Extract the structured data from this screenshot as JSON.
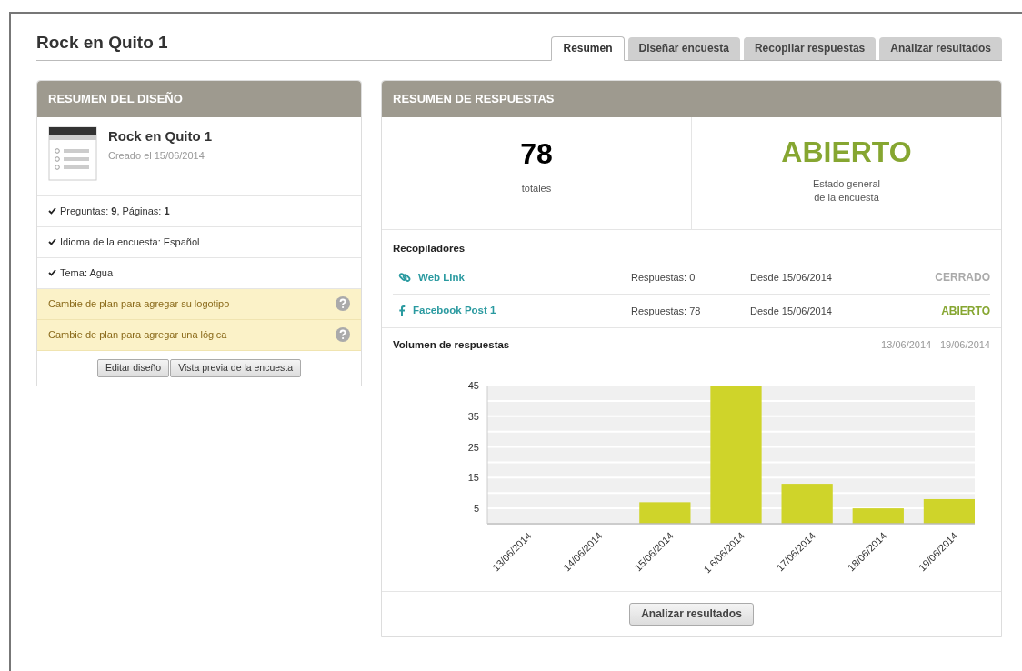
{
  "title": "Rock en Quito 1",
  "tabs": [
    {
      "label": "Resumen",
      "selected": true
    },
    {
      "label": "Diseñar encuesta",
      "selected": false
    },
    {
      "label": "Recopilar respuestas",
      "selected": false
    },
    {
      "label": "Analizar resultados",
      "selected": false
    }
  ],
  "design_summary": {
    "heading": "RESUMEN DEL DISEÑO",
    "survey_name": "Rock en Quito 1",
    "created": "Creado el 15/06/2014",
    "items": [
      {
        "kind": "check",
        "text": "Preguntas: **9**, Páginas: **1**"
      },
      {
        "kind": "check",
        "text": "Idioma de la encuesta: Español"
      },
      {
        "kind": "check",
        "text": "Tema: Agua"
      },
      {
        "kind": "upgrade",
        "text": "Cambie de plan para agregar su logotipo"
      },
      {
        "kind": "upgrade",
        "text": "Cambie de plan para agregar una lógica"
      }
    ],
    "buttons": [
      "Editar diseño",
      "Vista previa de la encuesta"
    ]
  },
  "response_summary": {
    "heading": "RESUMEN DE RESPUESTAS",
    "total": "78",
    "total_label": "totales",
    "status": "ABIERTO",
    "status_label": "Estado general\nde la encuesta",
    "collectors_title": "Recopiladores",
    "collectors": [
      {
        "kind": "link",
        "name": "Web Link",
        "responses": "Respuestas: 0",
        "since": "Desde 15/06/2014",
        "status": "CERRADO",
        "open": false
      },
      {
        "kind": "facebook",
        "name": "Facebook Post 1",
        "responses": "Respuestas: 78",
        "since": "Desde 15/06/2014",
        "status": "ABIERTO",
        "open": true
      }
    ],
    "volume_title": "Volumen de respuestas",
    "date_range": "13/06/2014 - 19/06/2014",
    "chart_data": {
      "type": "bar",
      "categories": [
        "13/06/2014",
        "14/06/2014",
        "15/06/2014",
        "1 6/06/2014",
        "17/06/2014",
        "18/06/2014",
        "19/06/2014"
      ],
      "series": [
        {
          "color": "#cfd42a",
          "values": [
            0,
            0,
            7,
            45,
            13,
            5,
            8
          ]
        }
      ],
      "ylim": [
        0,
        45
      ],
      "yticks": [
        5,
        15,
        25,
        35,
        45
      ],
      "grid": true
    },
    "button": "Analizar resultados"
  }
}
